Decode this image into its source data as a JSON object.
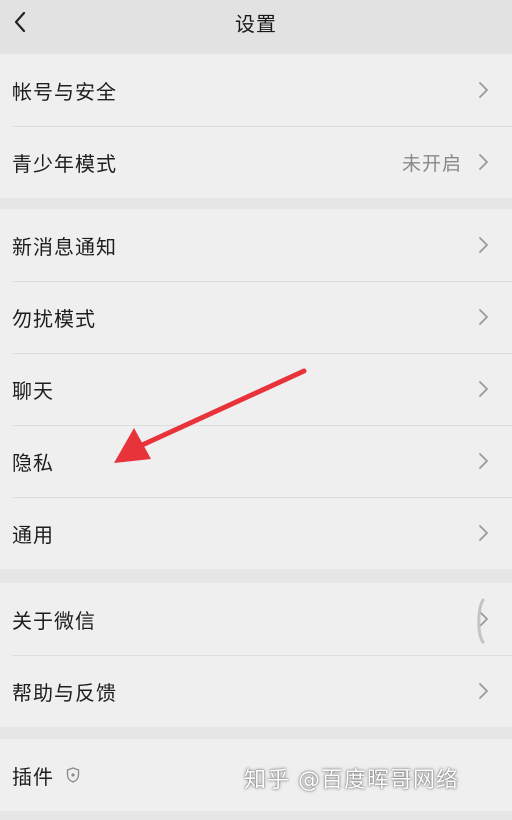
{
  "header": {
    "title": "设置",
    "back_icon": "chevron-left-icon"
  },
  "groups": [
    {
      "items": [
        {
          "label": "帐号与安全",
          "value": ""
        },
        {
          "label": "青少年模式",
          "value": "未开启"
        }
      ]
    },
    {
      "items": [
        {
          "label": "新消息通知",
          "value": ""
        },
        {
          "label": "勿扰模式",
          "value": ""
        },
        {
          "label": "聊天",
          "value": ""
        },
        {
          "label": "隐私",
          "value": ""
        },
        {
          "label": "通用",
          "value": ""
        }
      ]
    },
    {
      "items": [
        {
          "label": "关于微信",
          "value": ""
        },
        {
          "label": "帮助与反馈",
          "value": ""
        }
      ]
    },
    {
      "items": [
        {
          "label": "插件",
          "value": "",
          "icon": "shield-icon"
        }
      ]
    }
  ],
  "annotation": {
    "type": "arrow",
    "color": "#e8333a",
    "points_to": "隐私"
  },
  "watermark": "知乎 @百度晖哥网络",
  "colors": {
    "background": "#e6e6e6",
    "row_background": "#efefef",
    "secondary_text": "#888888"
  }
}
